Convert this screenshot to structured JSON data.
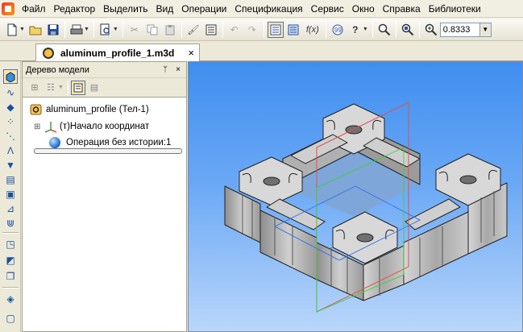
{
  "menu": [
    "Файл",
    "Редактор",
    "Выделить",
    "Вид",
    "Операции",
    "Спецификация",
    "Сервис",
    "Окно",
    "Справка",
    "Библиотеки"
  ],
  "toolbar": {
    "zoom_value": "0.8333",
    "fx_label": "f(x)"
  },
  "document_tab": {
    "title": "aluminum_profile_1.m3d",
    "close_glyph": "×"
  },
  "tree_panel": {
    "title": "Дерево модели",
    "pin_glyph": "ᛘ",
    "close_glyph": "×",
    "items": [
      {
        "label": "aluminum_profile (Тел-1)",
        "icon": "part-icon"
      },
      {
        "label": "(т)Начало координат",
        "icon": "origin-axes-icon",
        "expander": "⊞"
      },
      {
        "label": "Операция без истории:1",
        "icon": "sphere-body-icon"
      }
    ]
  },
  "colors": {
    "viewport_top": "#3f8ef0",
    "viewport_bottom": "#b9d6fa",
    "model_face": "#c8c8c8",
    "highlight": "#ffe8a6"
  }
}
